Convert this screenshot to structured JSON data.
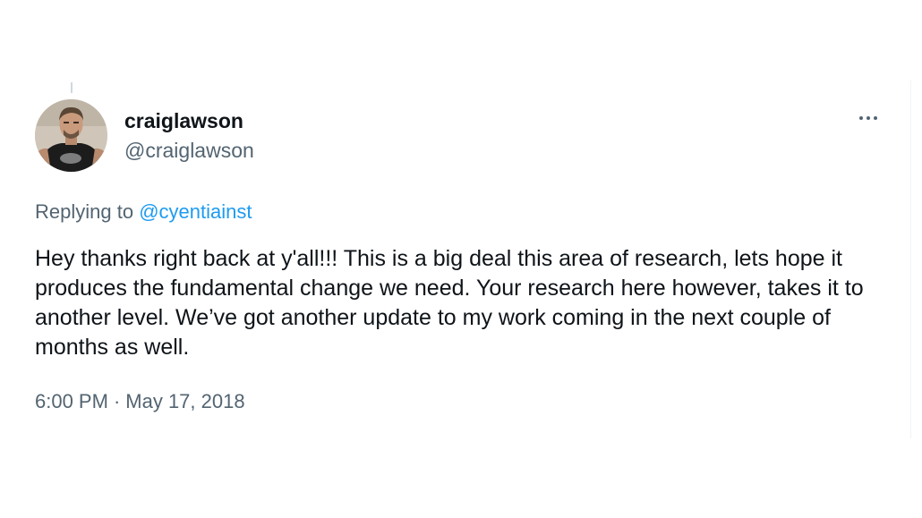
{
  "tweet": {
    "display_name": "craiglawson",
    "handle": "@craiglawson",
    "replying_prefix": "Replying to",
    "replying_to": "@cyentiainst",
    "text": "Hey thanks right back at y'all!!! This is a big deal this area of research, lets hope it produces the fundamental change we need. Your research here however, takes it to another level. We’ve got another update to my work coming in the next couple of months as well.",
    "time": "6:00 PM",
    "separator": "·",
    "date": "May 17, 2018",
    "more_icon": "more-horizontal-icon"
  },
  "colors": {
    "text_primary": "#0f1419",
    "text_secondary": "#536471",
    "link": "#1d9bf0",
    "background": "#ffffff"
  }
}
